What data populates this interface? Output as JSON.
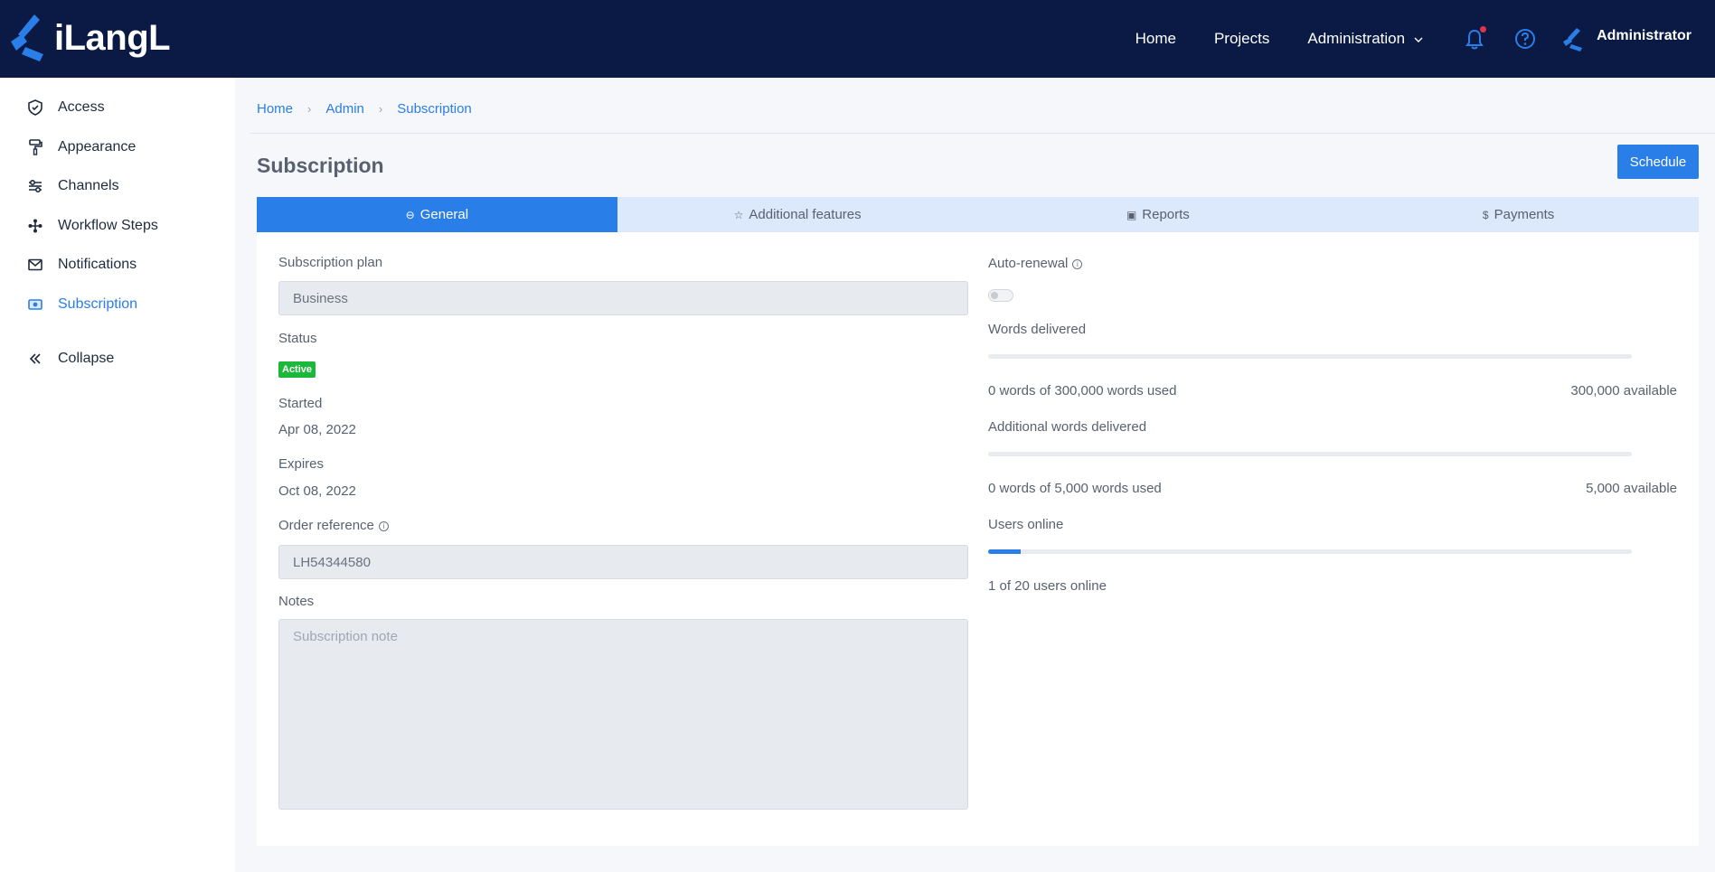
{
  "brand": {
    "name": "iLangL"
  },
  "nav": {
    "links": [
      "Home",
      "Projects",
      "Administration"
    ],
    "user": "Administrator",
    "icons": [
      "bell-icon",
      "help-icon",
      "user-logo-icon"
    ]
  },
  "sidebar": {
    "items": [
      {
        "label": "Access",
        "icon": "shield-check-icon"
      },
      {
        "label": "Appearance",
        "icon": "paint-roller-icon"
      },
      {
        "label": "Channels",
        "icon": "sliders-icon"
      },
      {
        "label": "Workflow Steps",
        "icon": "workflow-icon"
      },
      {
        "label": "Notifications",
        "icon": "mail-icon"
      },
      {
        "label": "Subscription",
        "icon": "money-icon",
        "active": true
      }
    ],
    "collapse": "Collapse"
  },
  "breadcrumb": [
    "Home",
    "Admin",
    "Subscription"
  ],
  "page": {
    "title": "Subscription",
    "schedule_label": "Schedule"
  },
  "tabs": [
    {
      "label": "General",
      "icon": "⊖",
      "active": true
    },
    {
      "label": "Additional features",
      "icon": "☆"
    },
    {
      "label": "Reports",
      "icon": "▣"
    },
    {
      "label": "Payments",
      "icon": "$"
    }
  ],
  "left": {
    "plan_label": "Subscription plan",
    "plan_value": "Business",
    "status_label": "Status",
    "status_value": "Active",
    "started_label": "Started",
    "started_value": "Apr 08, 2022",
    "expires_label": "Expires",
    "expires_value": "Oct 08, 2022",
    "order_label": "Order reference",
    "order_value": "LH54344580",
    "notes_label": "Notes",
    "notes_placeholder": "Subscription note"
  },
  "right": {
    "autorenew_label": "Auto-renewal",
    "autorenew_on": false,
    "words_label": "Words delivered",
    "words_used": "0 words of 300,000 words used",
    "words_available": "300,000 available",
    "words_fraction": 0,
    "add_words_label": "Additional words delivered",
    "add_words_used": "0 words of 5,000 words used",
    "add_words_available": "5,000 available",
    "add_words_fraction": 0,
    "users_label": "Users online",
    "users_text": "1 of 20 users online",
    "users_fraction": 0.05
  },
  "colors": {
    "navbar": "#0a1a45",
    "accent": "#2a7ee8",
    "success": "#1cb83a"
  }
}
